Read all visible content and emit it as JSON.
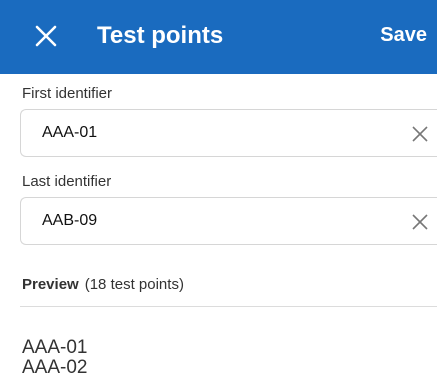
{
  "header": {
    "title": "Test points",
    "save_label": "Save",
    "close_icon": "close-icon",
    "background": "#1a6bbf"
  },
  "first": {
    "label": "First identifier",
    "value": "AAA-01",
    "clear_icon": "clear-icon"
  },
  "last": {
    "label": "Last identifier",
    "value": "AAB-09",
    "clear_icon": "clear-icon"
  },
  "preview": {
    "label": "Preview",
    "count": "(18 test points)",
    "items": [
      "AAA-01",
      "AAA-02"
    ]
  }
}
